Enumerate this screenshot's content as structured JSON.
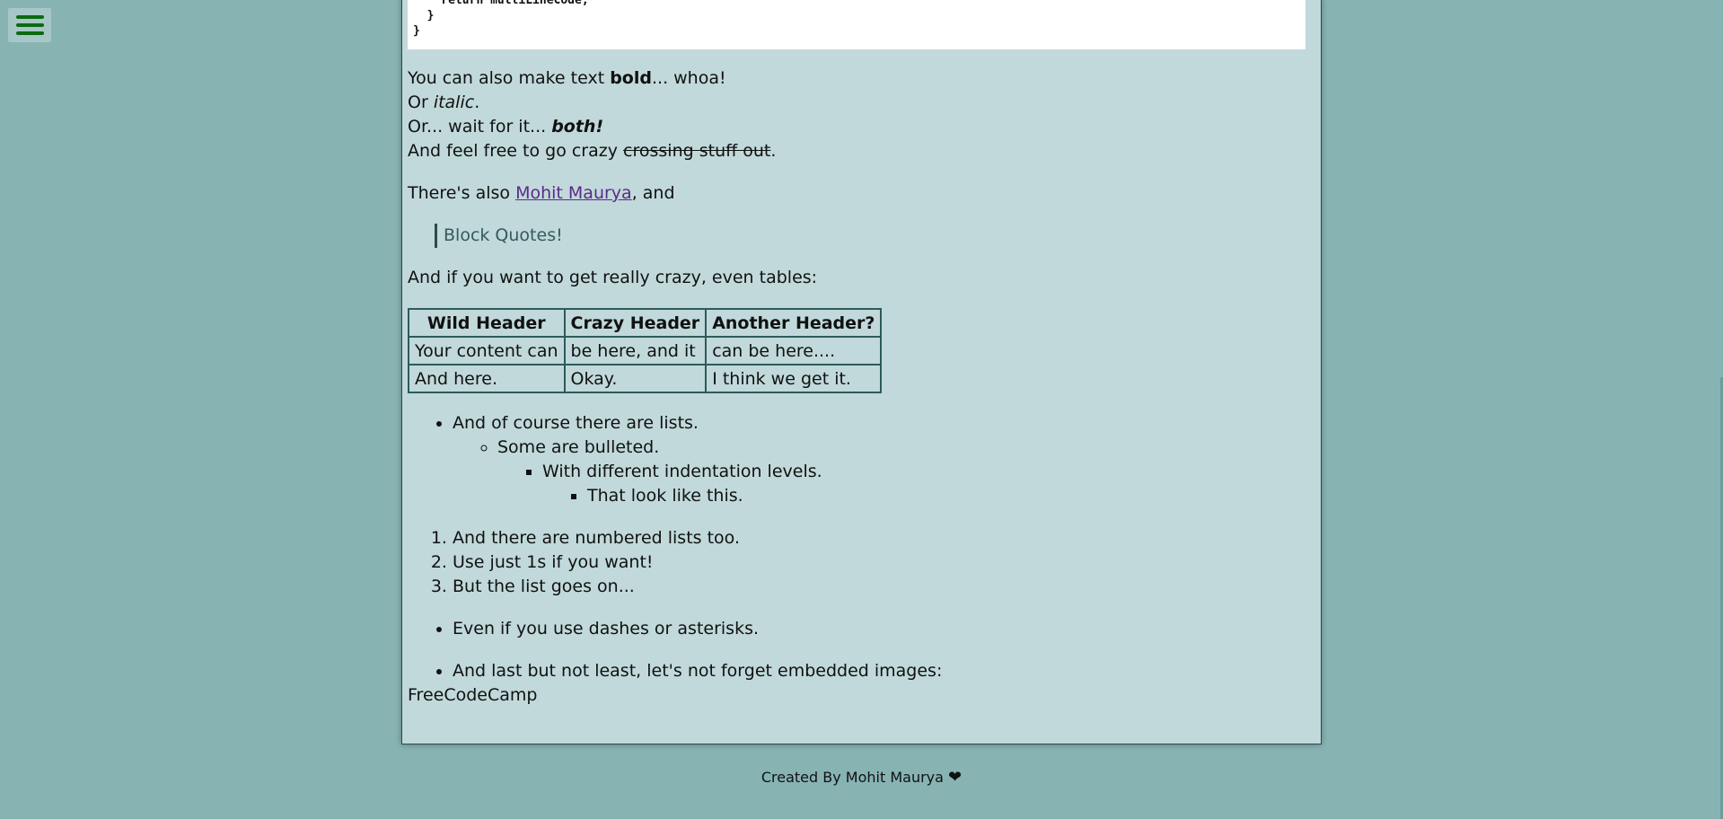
{
  "menu": {
    "icon": "hamburger-menu-icon"
  },
  "code": {
    "lines": [
      "    return multiLineCode;",
      "  }",
      "}"
    ]
  },
  "text": {
    "bold_line_pre": "You can also make text ",
    "bold_word": "bold",
    "bold_line_post": "... whoa!",
    "italic_pre": "Or ",
    "italic_word": "italic",
    "italic_post": ".",
    "both_pre": "Or... wait for it... ",
    "both_word": "both!",
    "strike_pre": "And feel free to go crazy ",
    "strike_word": "crossing stuff out",
    "strike_post": ".",
    "also_pre": "There's also ",
    "link_text": "Mohit Maurya",
    "also_post": ", and",
    "quote": "Block Quotes!",
    "tables_line": "And if you want to get really crazy, even tables:"
  },
  "table": {
    "headers": [
      "Wild Header",
      "Crazy Header",
      "Another Header?"
    ],
    "rows": [
      [
        "Your content can",
        "be here, and it",
        "can be here...."
      ],
      [
        "And here.",
        "Okay.",
        "I think we get it."
      ]
    ]
  },
  "lists": {
    "bullet_1": "And of course there are lists.",
    "bullet_2": "Some are bulleted.",
    "bullet_3": "With different indentation levels.",
    "bullet_4": "That look like this.",
    "numbered": [
      "And there are numbered lists too.",
      "Use just 1s if you want!",
      "But the list goes on..."
    ],
    "dashes": "Even if you use dashes or asterisks.",
    "images": "And last but not least, let's not forget embedded images:"
  },
  "image_alt": "FreeCodeCamp",
  "footer": {
    "text": "Created By Mohit Maurya ",
    "heart": "❤"
  },
  "colors": {
    "page_bg": "#87b3b3",
    "preview_bg": "#c1d9da",
    "link": "#5b2a8a",
    "menu_icon": "#0a6a10"
  }
}
